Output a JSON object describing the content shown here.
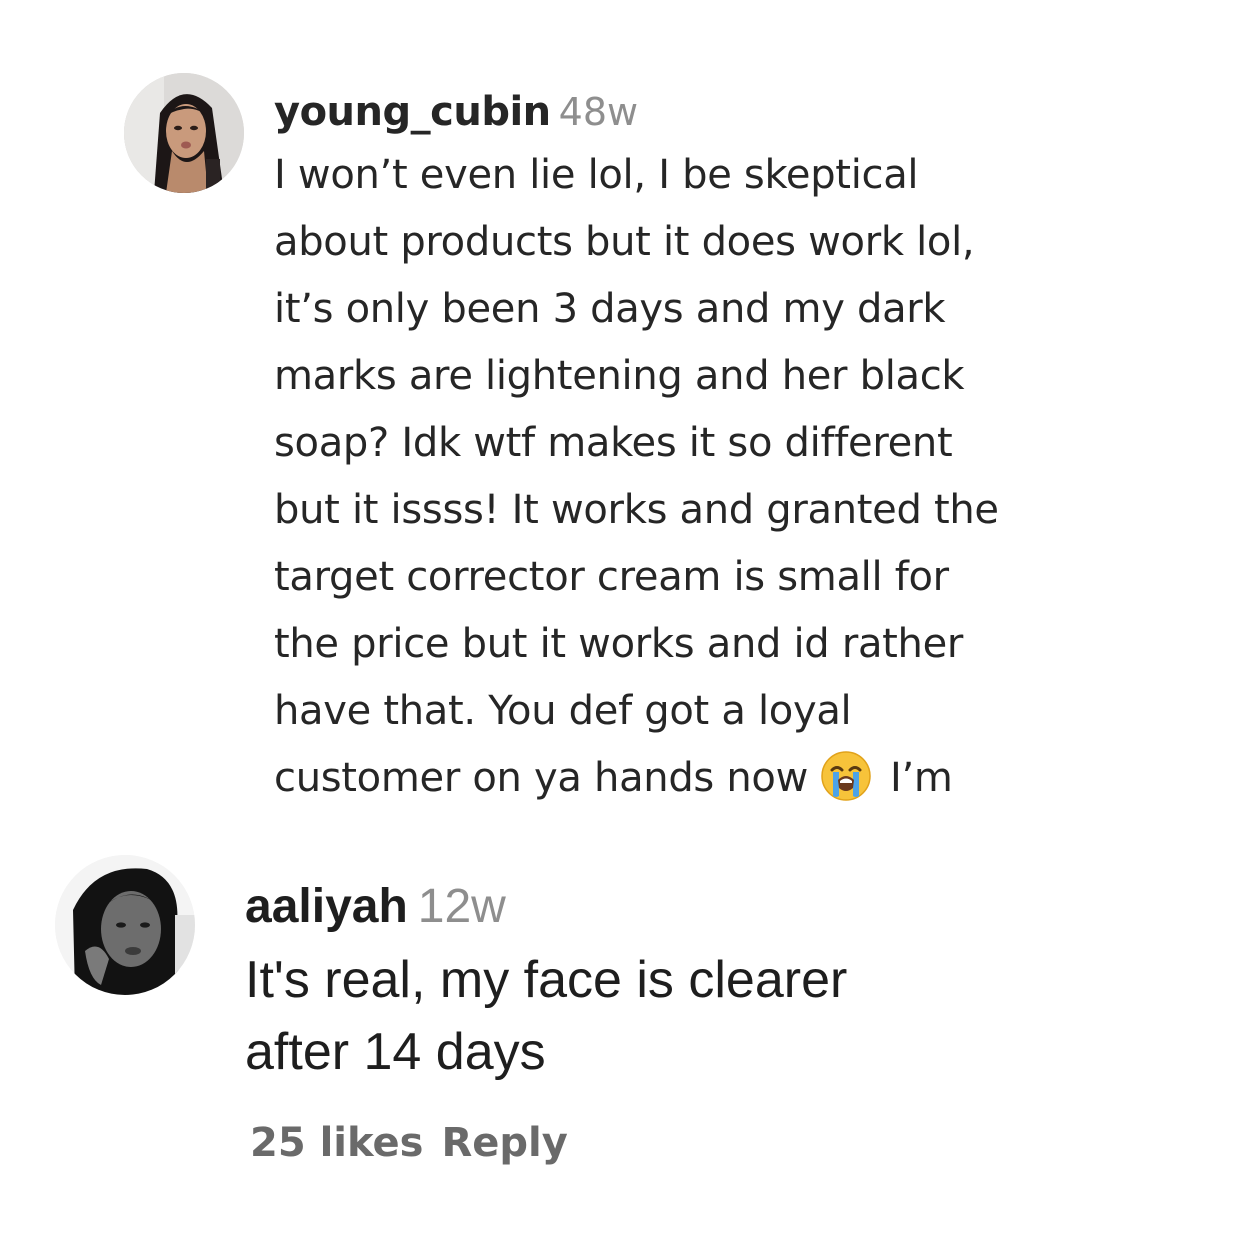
{
  "comments": [
    {
      "username": "young_cubin",
      "time": "48w",
      "lines": [
        "I won’t even lie lol, I be skeptical",
        "about products but it does work lol,",
        "it’s only been 3 days and my dark",
        "marks are lightening and her black",
        "soap? Idk wtf makes it so different",
        "but it issss! It works and granted the",
        "target corrector cream is small for",
        "the price but it works and id rather",
        "have that. You def got a loyal"
      ],
      "last_line_before_emoji": "customer on ya hands now",
      "emoji": "loudly-crying-face-emoji",
      "last_line_after_emoji": "I’m"
    },
    {
      "username": "aaliyah",
      "time": "12w",
      "lines": [
        "It's real, my face is clearer",
        "after 14 days"
      ],
      "likes": "25 likes",
      "reply_label": "Reply"
    }
  ],
  "colors": {
    "text_primary": "#262626",
    "text_secondary": "#8e8e8e",
    "actions_text": "#6a6a6a",
    "background": "#ffffff"
  }
}
